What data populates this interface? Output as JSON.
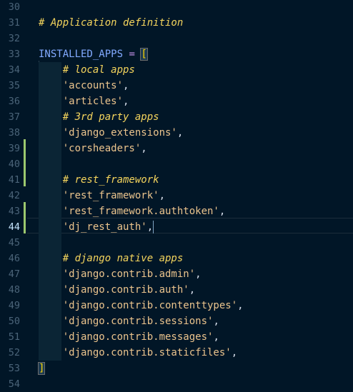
{
  "editor": {
    "active_line": "44",
    "diff_colors": {
      "changed": "#9cc86e"
    },
    "lines": [
      {
        "num": "30",
        "tokens": []
      },
      {
        "num": "31",
        "tokens": [
          {
            "t": "cm",
            "v": "# Application definition"
          }
        ]
      },
      {
        "num": "32",
        "tokens": []
      },
      {
        "num": "33",
        "tokens": [
          {
            "t": "var",
            "v": "INSTALLED_APPS"
          },
          {
            "t": "punc",
            "v": " "
          },
          {
            "t": "op",
            "v": "="
          },
          {
            "t": "punc",
            "v": " "
          },
          {
            "t": "bracket",
            "v": "["
          }
        ]
      },
      {
        "num": "34",
        "tokens": [
          {
            "t": "punc",
            "v": "    "
          },
          {
            "t": "cm",
            "v": "# local apps"
          }
        ]
      },
      {
        "num": "35",
        "tokens": [
          {
            "t": "punc",
            "v": "    "
          },
          {
            "t": "str",
            "v": "'accounts'"
          },
          {
            "t": "punc",
            "v": ","
          }
        ]
      },
      {
        "num": "36",
        "tokens": [
          {
            "t": "punc",
            "v": "    "
          },
          {
            "t": "str",
            "v": "'articles'"
          },
          {
            "t": "punc",
            "v": ","
          }
        ]
      },
      {
        "num": "37",
        "tokens": [
          {
            "t": "punc",
            "v": "    "
          },
          {
            "t": "cm",
            "v": "# 3rd party apps"
          }
        ]
      },
      {
        "num": "38",
        "tokens": [
          {
            "t": "punc",
            "v": "    "
          },
          {
            "t": "str",
            "v": "'django_extensions'"
          },
          {
            "t": "punc",
            "v": ","
          }
        ]
      },
      {
        "num": "39",
        "tokens": [
          {
            "t": "punc",
            "v": "    "
          },
          {
            "t": "str",
            "v": "'corsheaders'"
          },
          {
            "t": "punc",
            "v": ","
          }
        ]
      },
      {
        "num": "40",
        "tokens": []
      },
      {
        "num": "41",
        "tokens": [
          {
            "t": "punc",
            "v": "    "
          },
          {
            "t": "cm",
            "v": "# rest_framework"
          }
        ]
      },
      {
        "num": "42",
        "tokens": [
          {
            "t": "punc",
            "v": "    "
          },
          {
            "t": "str",
            "v": "'rest_framework'"
          },
          {
            "t": "punc",
            "v": ","
          }
        ]
      },
      {
        "num": "43",
        "tokens": [
          {
            "t": "punc",
            "v": "    "
          },
          {
            "t": "str",
            "v": "'rest_framework.authtoken'"
          },
          {
            "t": "punc",
            "v": ","
          }
        ]
      },
      {
        "num": "44",
        "tokens": [
          {
            "t": "punc",
            "v": "    "
          },
          {
            "t": "str",
            "v": "'dj_rest_auth'"
          },
          {
            "t": "punc",
            "v": ","
          }
        ]
      },
      {
        "num": "45",
        "tokens": []
      },
      {
        "num": "46",
        "tokens": [
          {
            "t": "punc",
            "v": "    "
          },
          {
            "t": "cm",
            "v": "# django native apps"
          }
        ]
      },
      {
        "num": "47",
        "tokens": [
          {
            "t": "punc",
            "v": "    "
          },
          {
            "t": "str",
            "v": "'django.contrib.admin'"
          },
          {
            "t": "punc",
            "v": ","
          }
        ]
      },
      {
        "num": "48",
        "tokens": [
          {
            "t": "punc",
            "v": "    "
          },
          {
            "t": "str",
            "v": "'django.contrib.auth'"
          },
          {
            "t": "punc",
            "v": ","
          }
        ]
      },
      {
        "num": "49",
        "tokens": [
          {
            "t": "punc",
            "v": "    "
          },
          {
            "t": "str",
            "v": "'django.contrib.contenttypes'"
          },
          {
            "t": "punc",
            "v": ","
          }
        ]
      },
      {
        "num": "50",
        "tokens": [
          {
            "t": "punc",
            "v": "    "
          },
          {
            "t": "str",
            "v": "'django.contrib.sessions'"
          },
          {
            "t": "punc",
            "v": ","
          }
        ]
      },
      {
        "num": "51",
        "tokens": [
          {
            "t": "punc",
            "v": "    "
          },
          {
            "t": "str",
            "v": "'django.contrib.messages'"
          },
          {
            "t": "punc",
            "v": ","
          }
        ]
      },
      {
        "num": "52",
        "tokens": [
          {
            "t": "punc",
            "v": "    "
          },
          {
            "t": "str",
            "v": "'django.contrib.staticfiles'"
          },
          {
            "t": "punc",
            "v": ","
          }
        ]
      },
      {
        "num": "53",
        "tokens": [
          {
            "t": "bracket",
            "v": "]"
          }
        ]
      },
      {
        "num": "54",
        "tokens": []
      }
    ]
  }
}
